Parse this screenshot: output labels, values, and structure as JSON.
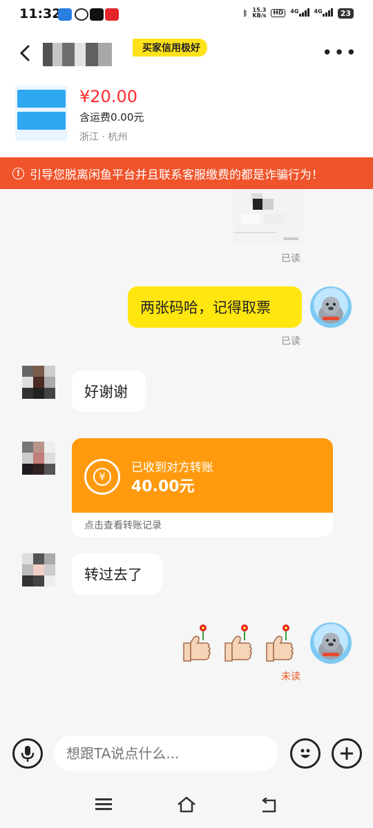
{
  "status_bar": {
    "time": "11:32",
    "speed_top": "15.3",
    "speed_bottom": "KB/s",
    "hd": "HD",
    "net1": "4G",
    "net2": "4G",
    "battery": "23"
  },
  "header": {
    "badge": "买家信用极好",
    "icons": {
      "back": "back-arrow-icon",
      "more": "more-dots-icon"
    }
  },
  "product": {
    "price": "¥20.00",
    "shipping": "含运费0.00元",
    "location": "浙江 · 杭州"
  },
  "warning": {
    "text": "引导您脱离闲鱼平台并且联系客服缴费的都是诈骗行为！"
  },
  "chat": {
    "read_1": "已读",
    "msg_out_1": "两张码哈，记得取票",
    "read_2": "已读",
    "msg_in_1": "好谢谢",
    "transfer": {
      "title": "已收到对方转账",
      "amount": "40.00元",
      "footer": "点击查看转账记录",
      "icon": "yuan-coin-icon"
    },
    "msg_in_2": "转过去了",
    "unread": "未读",
    "colors": {
      "outgoing_bubble": "#ffe60f",
      "transfer_card": "#ff9a0e",
      "warning_bar": "#f0542b",
      "price": "#ff2b2b",
      "unread": "#e8541e"
    }
  },
  "input_bar": {
    "placeholder": "想跟TA说点什么...",
    "icons": {
      "voice": "microphone-icon",
      "emoji": "emoji-icon",
      "add": "plus-icon"
    }
  },
  "nav_bar": {
    "icons": [
      "menu-icon",
      "home-icon",
      "back-icon"
    ]
  }
}
